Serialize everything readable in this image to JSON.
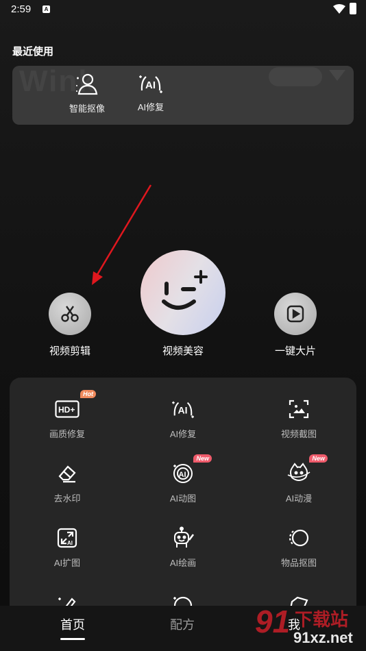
{
  "status": {
    "time": "2:59",
    "sim": "A"
  },
  "recent": {
    "title": "最近使用",
    "watermark": "Wink",
    "items": [
      {
        "label": "智能抠像",
        "icon": "person-cutout-icon"
      },
      {
        "label": "AI修复",
        "icon": "ai-sparkle-icon"
      }
    ]
  },
  "main_actions": [
    {
      "label": "视频剪辑",
      "icon": "scissors-icon"
    },
    {
      "label": "视频美容",
      "icon": "wink-face-icon"
    },
    {
      "label": "一键大片",
      "icon": "play-square-icon"
    }
  ],
  "tools": [
    {
      "label": "画质修复",
      "icon": "hd-plus-icon",
      "badge": "Hot"
    },
    {
      "label": "AI修复",
      "icon": "ai-sparkle-icon",
      "badge": ""
    },
    {
      "label": "视频截图",
      "icon": "frame-capture-icon",
      "badge": ""
    },
    {
      "label": "去水印",
      "icon": "eraser-icon",
      "badge": ""
    },
    {
      "label": "AI动图",
      "icon": "ai-motion-icon",
      "badge": "New"
    },
    {
      "label": "AI动漫",
      "icon": "ai-anime-icon",
      "badge": "New"
    },
    {
      "label": "AI扩图",
      "icon": "ai-expand-icon",
      "badge": ""
    },
    {
      "label": "AI绘画",
      "icon": "ai-paint-icon",
      "badge": ""
    },
    {
      "label": "物品抠图",
      "icon": "object-cutout-icon",
      "badge": ""
    }
  ],
  "tabs": [
    {
      "label": "首页",
      "active": true
    },
    {
      "label": "配方",
      "active": false
    },
    {
      "label": "我",
      "active": false
    }
  ],
  "brand_watermark": {
    "digits": "91",
    "text": "下载站",
    "url": "91xz.net"
  },
  "colors": {
    "hot": "#f08a5d",
    "new": "#ef5b6b",
    "arrow": "#e0171e"
  }
}
